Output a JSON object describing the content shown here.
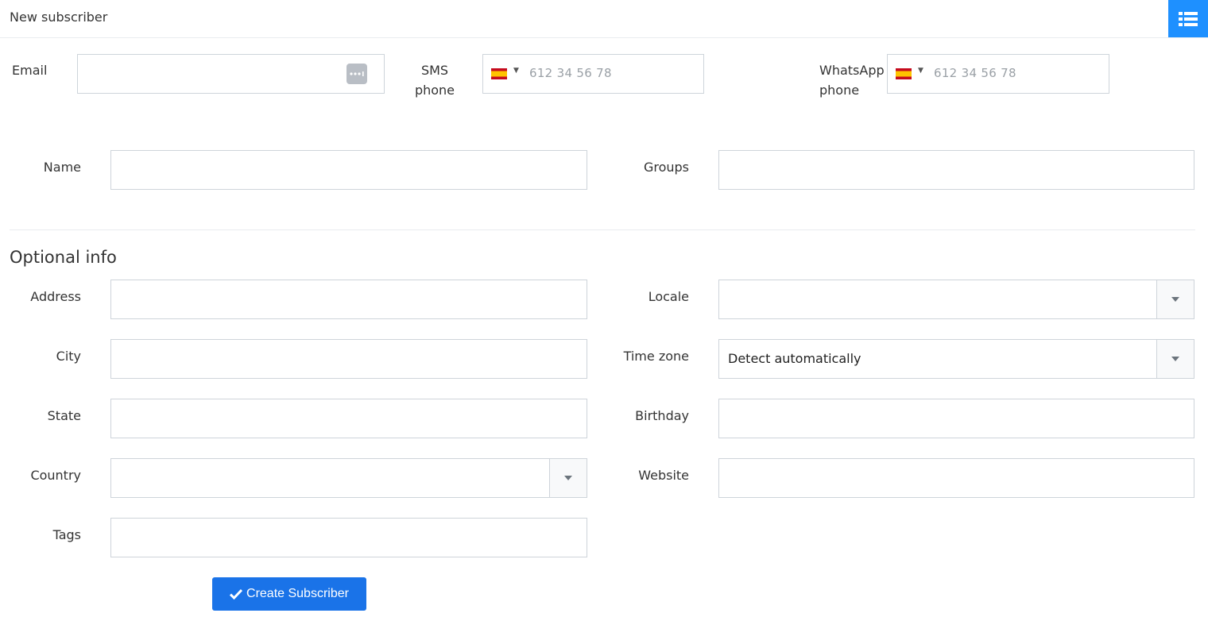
{
  "header": {
    "title": "New subscriber",
    "list_icon": "list-icon"
  },
  "contact": {
    "email_label": "Email",
    "email_value": "",
    "sms_label_line1": "SMS",
    "sms_label_line2": "phone",
    "sms_placeholder": "612 34 56 78",
    "whatsapp_label_line1": "WhatsApp",
    "whatsapp_label_line2": "phone",
    "whatsapp_placeholder": "612 34 56 78",
    "flag": "spain-flag-icon"
  },
  "basic": {
    "name_label": "Name",
    "groups_label": "Groups"
  },
  "optional": {
    "section_title": "Optional info",
    "address_label": "Address",
    "city_label": "City",
    "state_label": "State",
    "country_label": "Country",
    "tags_label": "Tags",
    "locale_label": "Locale",
    "timezone_label": "Time zone",
    "timezone_value": "Detect automatically",
    "birthday_label": "Birthday",
    "website_label": "Website"
  },
  "actions": {
    "create_label": "Create Subscriber"
  },
  "colors": {
    "accent": "#1a73e8",
    "list_button": "#1e90ff"
  }
}
